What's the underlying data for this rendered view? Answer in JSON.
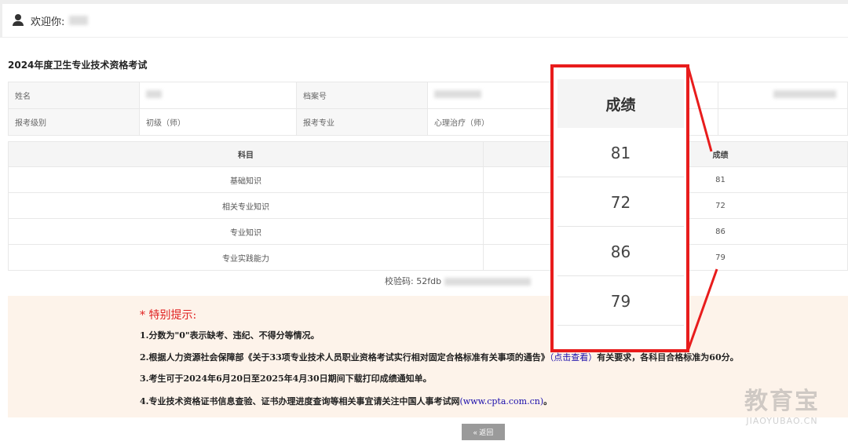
{
  "header": {
    "welcome": "欢迎你:"
  },
  "exam": {
    "title": "2024年度卫生专业技术资格考试"
  },
  "info": {
    "name_label": "姓名",
    "file_no_label": "档案号",
    "level_label": "报考级别",
    "level_value": "初级（师）",
    "major_label": "报考专业",
    "major_value": "心理治疗（师）"
  },
  "scores": {
    "col_subject": "科目",
    "col_score": "成绩",
    "rows": [
      {
        "subject": "基础知识",
        "score": "81"
      },
      {
        "subject": "相关专业知识",
        "score": "72"
      },
      {
        "subject": "专业知识",
        "score": "86"
      },
      {
        "subject": "专业实践能力",
        "score": "79"
      }
    ]
  },
  "verify": {
    "label": "校验码:",
    "code_prefix": "52fdb"
  },
  "notice": {
    "title": "* 特别提示:",
    "line1": "1.分数为\"0\"表示缺考、违纪、不得分等情况。",
    "line2_a": "2.根据人力资源社会保障部《关于33项专业技术人员职业资格考试实行相对固定合格标准有关事项的通告》",
    "line2_link": "（点击查看）",
    "line2_b": "有关要求，各科目合格标准为60分。",
    "line3": "3.考生可于2024年6月20日至2025年4月30日期间下载打印成绩通知单。",
    "line4_a": "4.专业技术资格证书信息查验、证书办理进度查询等相关事宜请关注中国人事考试网",
    "line4_link": "(www.cpta.com.cn)",
    "line4_b": "。"
  },
  "back_button": {
    "label": "« 返回"
  },
  "zoom": {
    "header": "成绩",
    "values": [
      "81",
      "72",
      "86",
      "79"
    ]
  },
  "watermark": {
    "cn": "教育宝",
    "en": "JIAOYUBAO.CN"
  },
  "colors": {
    "highlight": "#e81c1c",
    "notice_bg": "#fdf3ea",
    "notice_title": "#e02020"
  }
}
